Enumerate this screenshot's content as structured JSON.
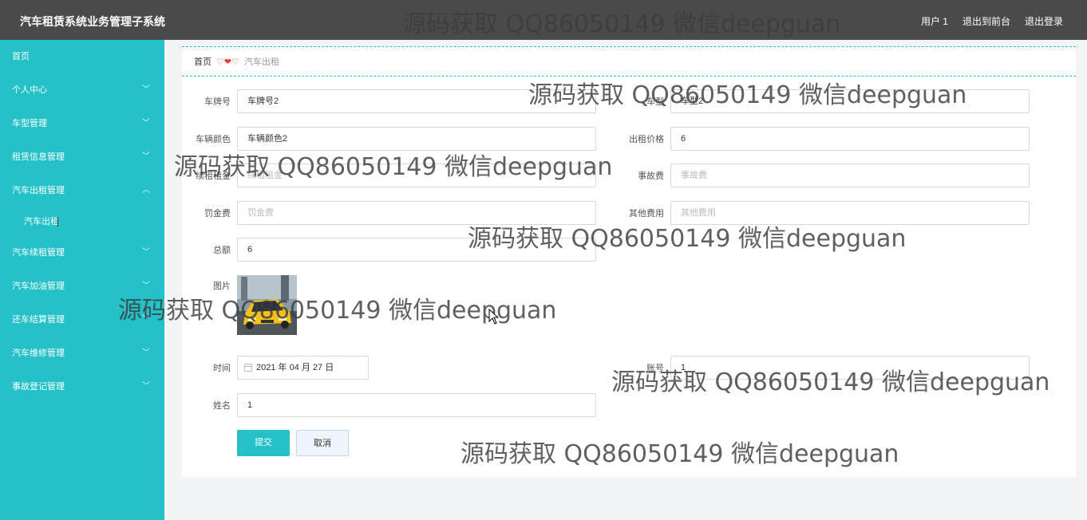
{
  "header": {
    "title": "汽车租赁系统业务管理子系统",
    "user": "用户 1",
    "back_to_front": "退出到前台",
    "logout": "退出登录"
  },
  "sidebar": {
    "items": [
      {
        "label": "首页"
      },
      {
        "label": "个人中心"
      },
      {
        "label": "车型管理"
      },
      {
        "label": "租赁信息管理"
      },
      {
        "label": "汽车出租管理"
      },
      {
        "label": "汽车出租"
      },
      {
        "label": "汽车续租管理"
      },
      {
        "label": "汽车加油管理"
      },
      {
        "label": "还车结算管理"
      },
      {
        "label": "汽车维修管理"
      },
      {
        "label": "事故登记管理"
      }
    ]
  },
  "breadcrumb": {
    "home": "首页",
    "separator": "♡❤♡",
    "current": "汽车出租"
  },
  "form": {
    "plate": {
      "label": "车牌号",
      "value": "车牌号2"
    },
    "model": {
      "label": "车型",
      "value": "车型2"
    },
    "color": {
      "label": "车辆颜色",
      "value": "车辆颜色2"
    },
    "price": {
      "label": "出租价格",
      "value": "6"
    },
    "renew_rent": {
      "label": "续租租金",
      "placeholder": "续租租金"
    },
    "accident_fee": {
      "label": "事故费",
      "placeholder": "事故费"
    },
    "fine": {
      "label": "罚金费",
      "placeholder": "罚金费"
    },
    "other_fee": {
      "label": "其他费用",
      "placeholder": "其他费用"
    },
    "total": {
      "label": "总额",
      "value": "6"
    },
    "image": {
      "label": "图片"
    },
    "time": {
      "label": "时间",
      "value": "2021 年 04 月 27 日"
    },
    "account": {
      "label": "账号",
      "value": "1"
    },
    "name": {
      "label": "姓名",
      "value": "1"
    },
    "submit": "提交",
    "cancel": "取消"
  },
  "watermark": "源码获取 QQ86050149 微信deepguan",
  "colors": {
    "accent": "#25c1c9",
    "topbar": "#4a4a4a"
  }
}
